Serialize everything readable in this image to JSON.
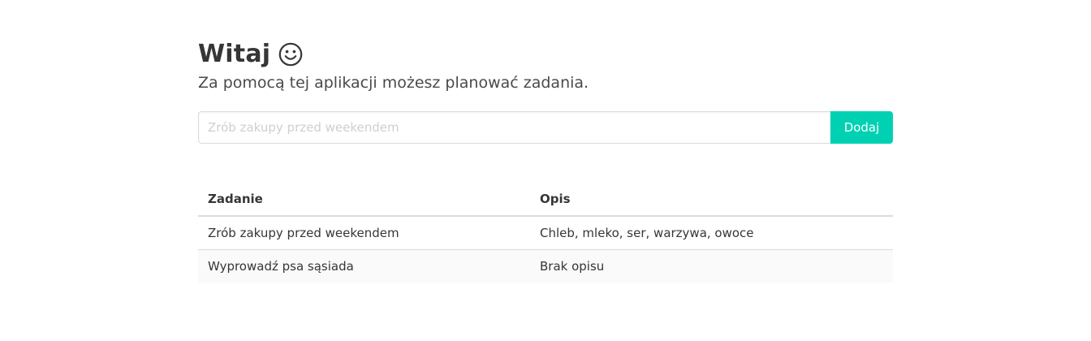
{
  "header": {
    "title": "Witaj",
    "icon": "smiley-icon",
    "subtitle": "Za pomocą tej aplikacji możesz planować zadania."
  },
  "form": {
    "placeholder": "Zrób zakupy przed weekendem",
    "value": "",
    "add_label": "Dodaj",
    "accent_color": "#00d1b2"
  },
  "table": {
    "columns": [
      "Zadanie",
      "Opis"
    ],
    "rows": [
      {
        "task": "Zrób zakupy przed weekendem",
        "description": "Chleb, mleko, ser, warzywa, owoce"
      },
      {
        "task": "Wyprowadź psa sąsiada",
        "description": "Brak opisu"
      }
    ]
  }
}
